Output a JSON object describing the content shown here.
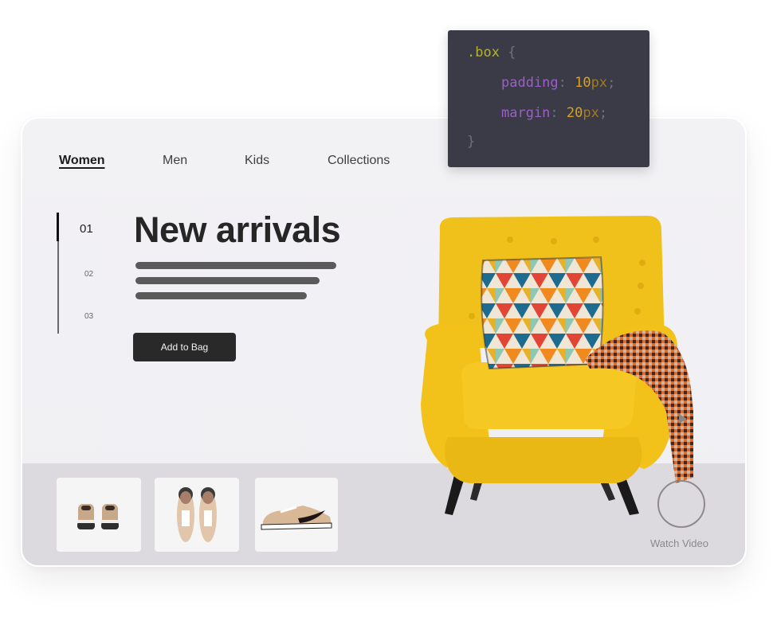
{
  "nav": {
    "items": [
      {
        "label": "Women",
        "active": true
      },
      {
        "label": "Men",
        "active": false
      },
      {
        "label": "Kids",
        "active": false
      },
      {
        "label": "Collections",
        "active": false
      }
    ]
  },
  "hero": {
    "slides": [
      "01",
      "02",
      "03"
    ],
    "active_slide": "01",
    "title": "New arrivals",
    "add_to_bag_label": "Add to Bag"
  },
  "thumbnails": [
    {
      "alt": "sneakers-back-view"
    },
    {
      "alt": "sneakers-top-view"
    },
    {
      "alt": "sneaker-side-view"
    }
  ],
  "video": {
    "label": "Watch Video"
  },
  "code_snippet": {
    "selector_dot": ".",
    "selector": "box",
    "open_brace": "{",
    "close_brace": "}",
    "rules": [
      {
        "property": "padding",
        "value": "10",
        "unit": "px"
      },
      {
        "property": "margin",
        "value": "20",
        "unit": "px"
      }
    ],
    "colon": ":",
    "semicolon": ";"
  },
  "colors": {
    "accent_dark": "#2a2929",
    "chair_yellow": "#f2c21a",
    "code_bg": "#3a3b46",
    "code_property": "#9b5fc7",
    "code_number": "#d9a21c",
    "code_selector": "#b2b23a"
  }
}
